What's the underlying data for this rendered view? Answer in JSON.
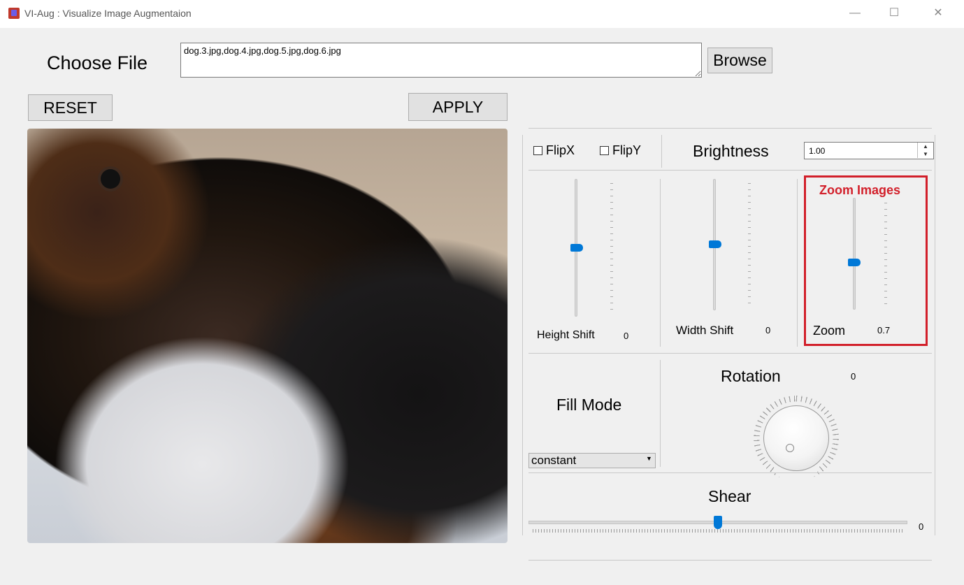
{
  "window": {
    "title": "VI-Aug : Visualize Image Augmentaion",
    "minimize": "—",
    "maximize": "☐",
    "close": "✕"
  },
  "file": {
    "label": "Choose File",
    "value": "dog.3.jpg,dog.4.jpg,dog.5.jpg,dog.6.jpg",
    "browse_label": "Browse"
  },
  "actions": {
    "reset_label": "RESET",
    "apply_label": "APPLY"
  },
  "flips": {
    "flipx_label": "FlipX",
    "flipy_label": "FlipY"
  },
  "brightness": {
    "label": "Brightness",
    "value": "1.00"
  },
  "height_shift": {
    "label": "Height Shift",
    "value": "0"
  },
  "width_shift": {
    "label": "Width Shift",
    "value": "0"
  },
  "zoom": {
    "title": "Zoom Images",
    "label": "Zoom",
    "value": "0.7"
  },
  "fill_mode": {
    "label": "Fill Mode",
    "selected": "constant"
  },
  "rotation": {
    "label": "Rotation",
    "value": "0"
  },
  "shear": {
    "label": "Shear",
    "value": "0"
  },
  "colors": {
    "accent": "#0078d7",
    "highlight": "#d21f2a"
  }
}
